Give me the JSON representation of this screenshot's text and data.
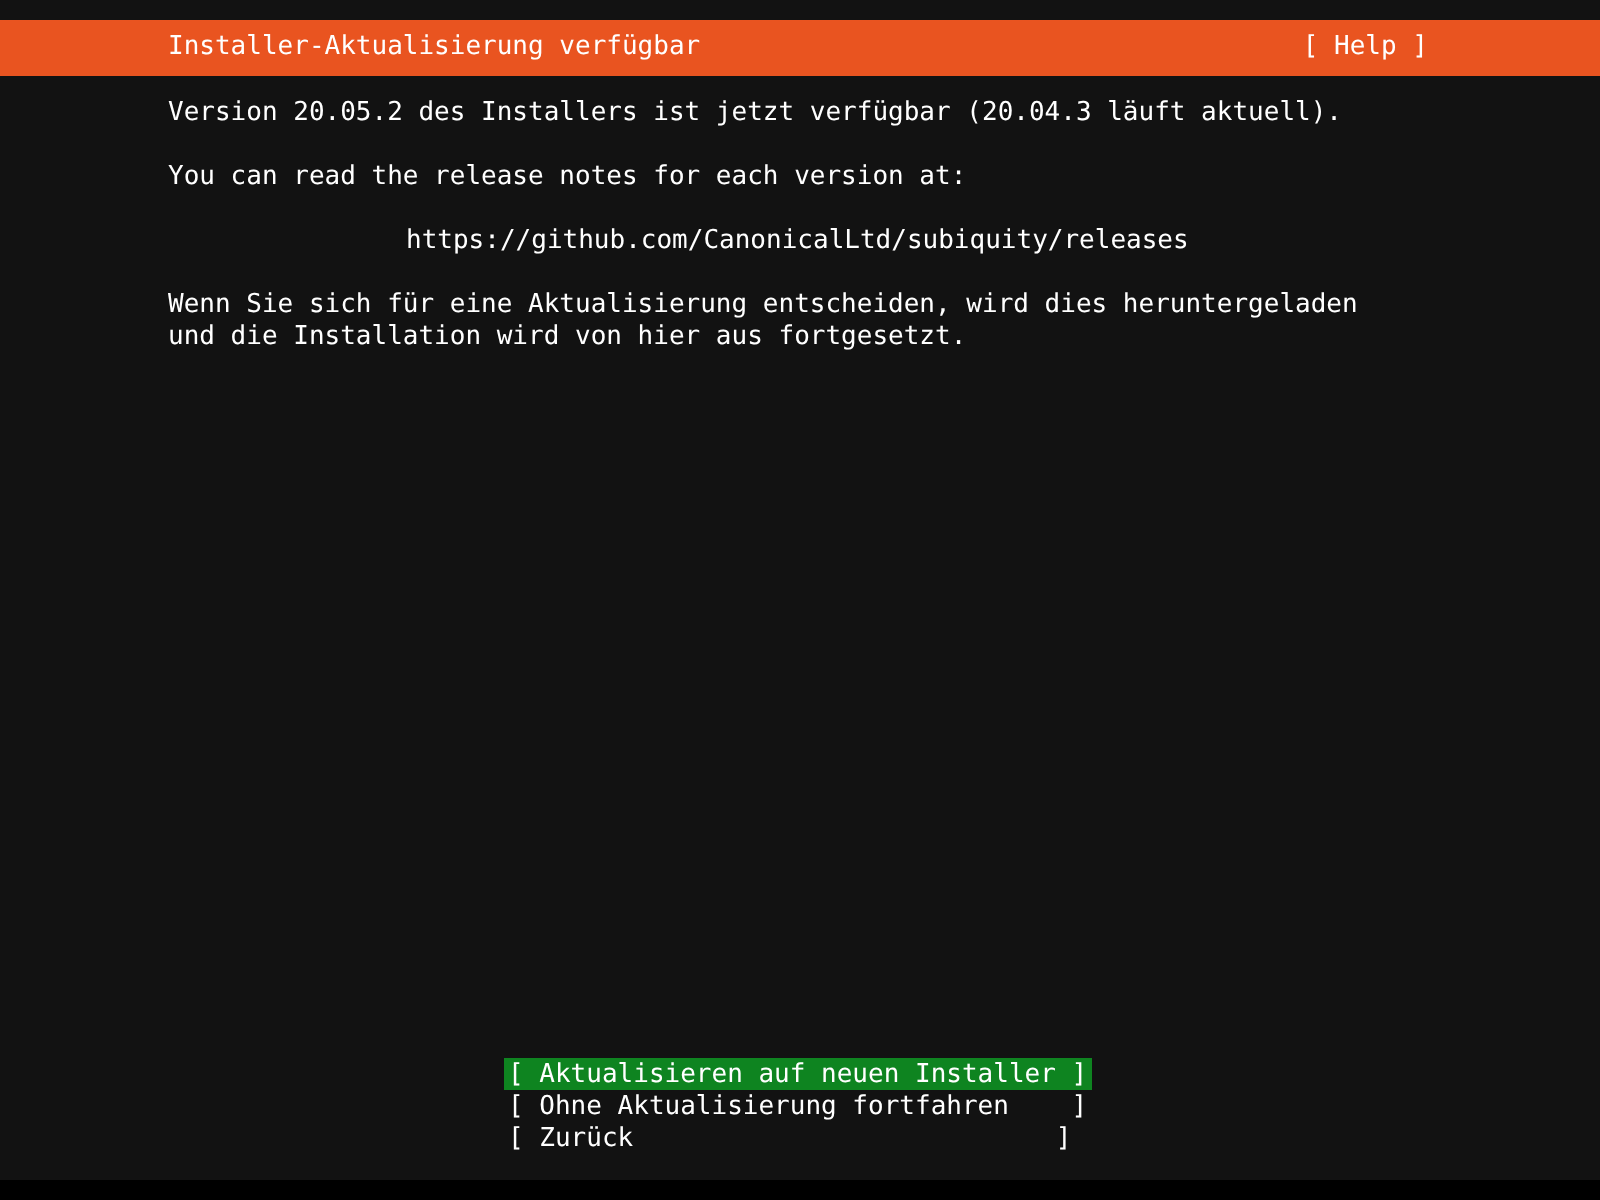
{
  "header": {
    "title": "Installer-Aktualisierung verfügbar",
    "help": "[ Help ]"
  },
  "paragraphs": [
    {
      "kind": "text",
      "lines": [
        "Version 20.05.2 des Installers ist jetzt verfügbar (20.04.3 läuft aktuell)."
      ]
    },
    {
      "kind": "text",
      "lines": [
        "You can read the release notes for each version at:"
      ]
    },
    {
      "kind": "link",
      "lines": [
        "https://github.com/CanonicalLtd/subiquity/releases"
      ]
    },
    {
      "kind": "text",
      "lines": [
        "Wenn Sie sich für eine Aktualisierung entscheiden, wird dies heruntergeladen",
        "und die Installation wird von hier aus fortgesetzt."
      ]
    }
  ],
  "buttons": [
    {
      "label": "[ Aktualisieren auf neuen Installer ]",
      "selected": true
    },
    {
      "label": "[ Ohne Aktualisierung fortfahren    ]",
      "selected": false
    },
    {
      "label": "[ Zurück                           ]",
      "selected": false
    }
  ]
}
